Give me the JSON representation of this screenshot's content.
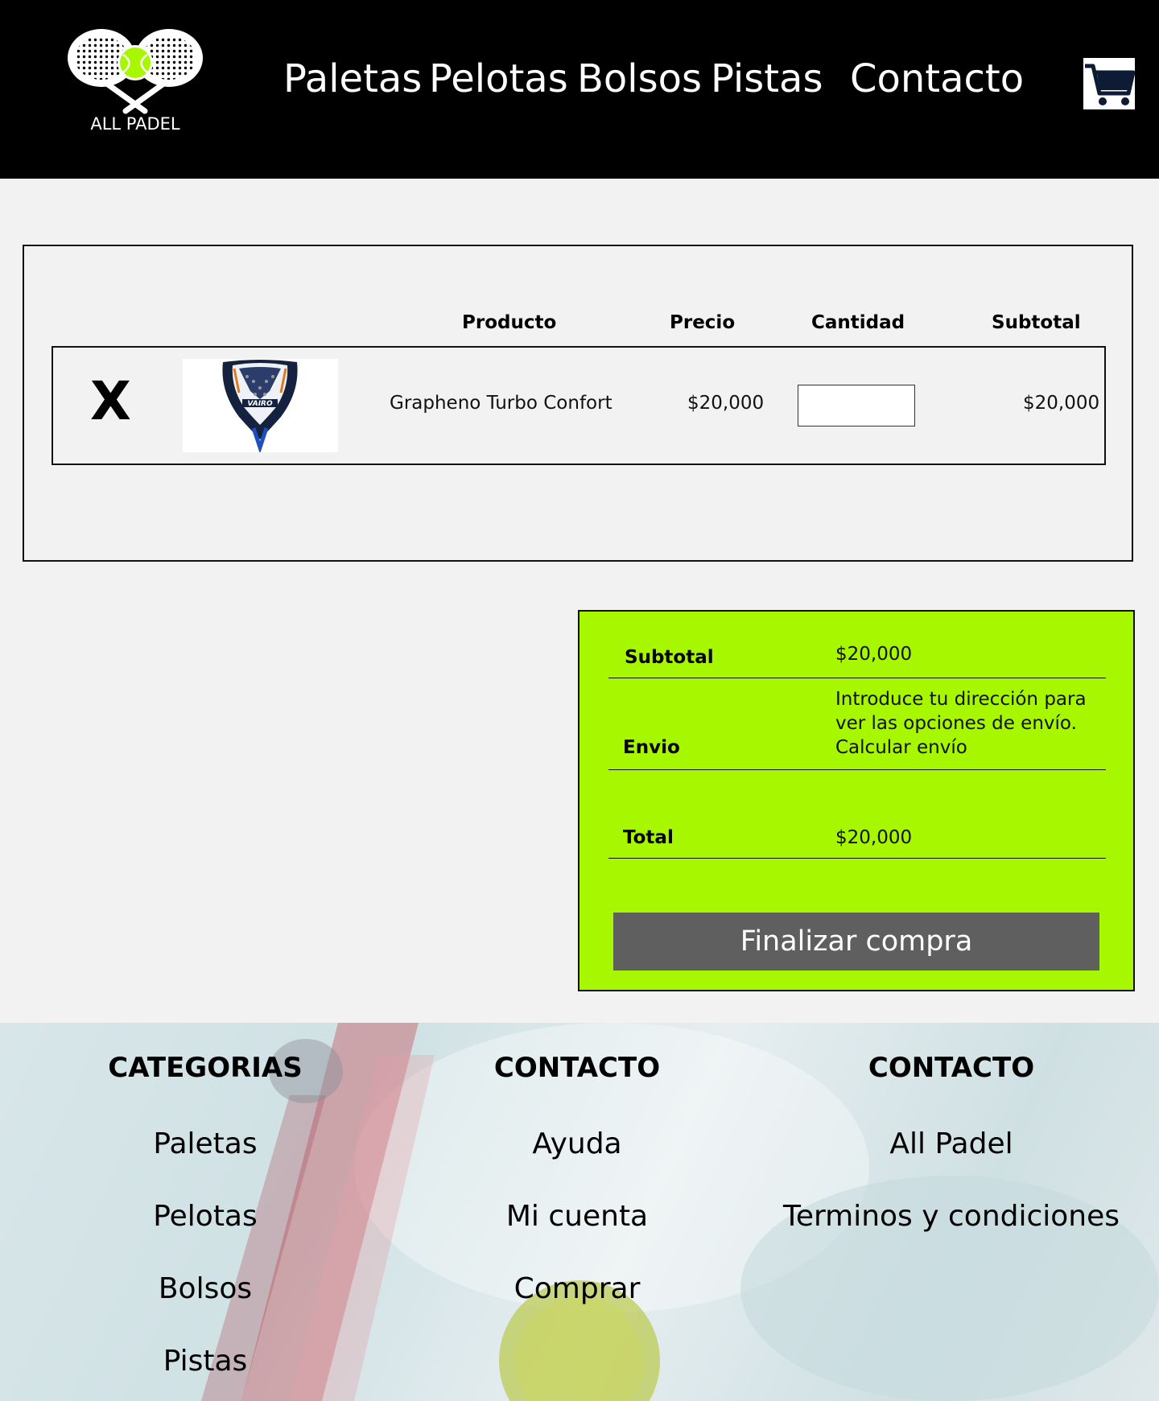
{
  "header": {
    "logo_text": "ALL PADEL",
    "nav": [
      "Paletas",
      "Pelotas",
      "Bolsos",
      "Pistas",
      "Contacto"
    ]
  },
  "cart_table": {
    "headers": {
      "product": "Producto",
      "price": "Precio",
      "quantity": "Cantidad",
      "subtotal": "Subtotal"
    },
    "items": [
      {
        "remove_label": "X",
        "image_brand": "VAIRO",
        "name": "Grapheno Turbo Confort",
        "price": "$20,000",
        "quantity": "",
        "subtotal": "$20,000"
      }
    ]
  },
  "totals": {
    "subtotal_label": "Subtotal",
    "subtotal_value": "$20,000",
    "shipping_label": "Envio",
    "shipping_text_1": "Introduce tu dirección para",
    "shipping_text_2": "ver las opciones de envío.",
    "shipping_link": "Calcular envío",
    "total_label": "Total",
    "total_value": "$20,000",
    "checkout_label": "Finalizar compra"
  },
  "footer": {
    "columns": [
      {
        "heading": "CATEGORIAS",
        "links": [
          "Paletas",
          "Pelotas",
          "Bolsos",
          "Pistas"
        ]
      },
      {
        "heading": "CONTACTO",
        "links": [
          "Ayuda",
          "Mi cuenta",
          "Comprar"
        ]
      },
      {
        "heading": "CONTACTO",
        "links": [
          "All Padel",
          "Terminos y condiciones"
        ]
      }
    ]
  },
  "colors": {
    "header_bg": "#000000",
    "page_bg": "#f2f2f2",
    "totals_bg": "#a6f700",
    "checkout_bg": "#5f5f5f",
    "ball": "#a6f700"
  },
  "icons": {
    "logo": "padel-rackets-ball-icon",
    "cart": "shopping-cart-icon"
  }
}
